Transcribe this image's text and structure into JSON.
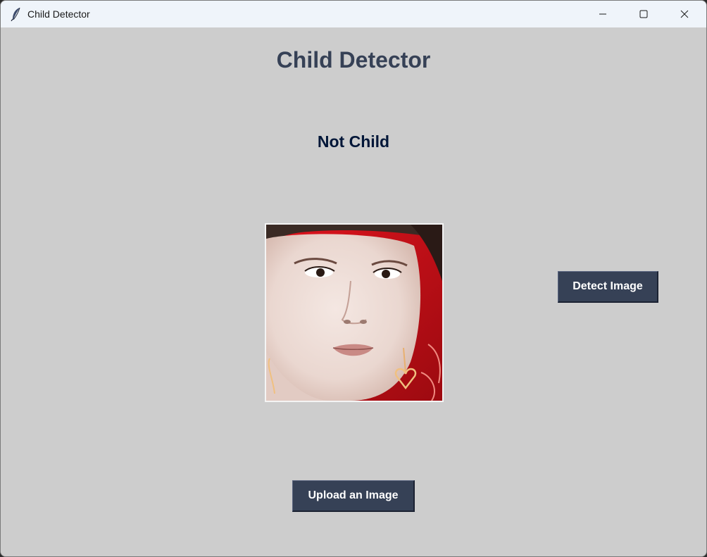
{
  "window": {
    "title": "Child Detector",
    "app_icon": "feather-icon",
    "controls": {
      "minimize": "minimize-icon",
      "maximize": "maximize-icon",
      "close": "close-icon"
    }
  },
  "main": {
    "heading": "Child Detector",
    "result_label": "Not Child",
    "preview_image": "face-photo",
    "detect_button": "Detect Image",
    "upload_button": "Upload an Image"
  },
  "colors": {
    "background": "#cdcdcd",
    "heading": "#364156",
    "result": "#011638",
    "button_bg": "#364156",
    "button_text": "#ffffff",
    "titlebar": "#eff4fa"
  }
}
